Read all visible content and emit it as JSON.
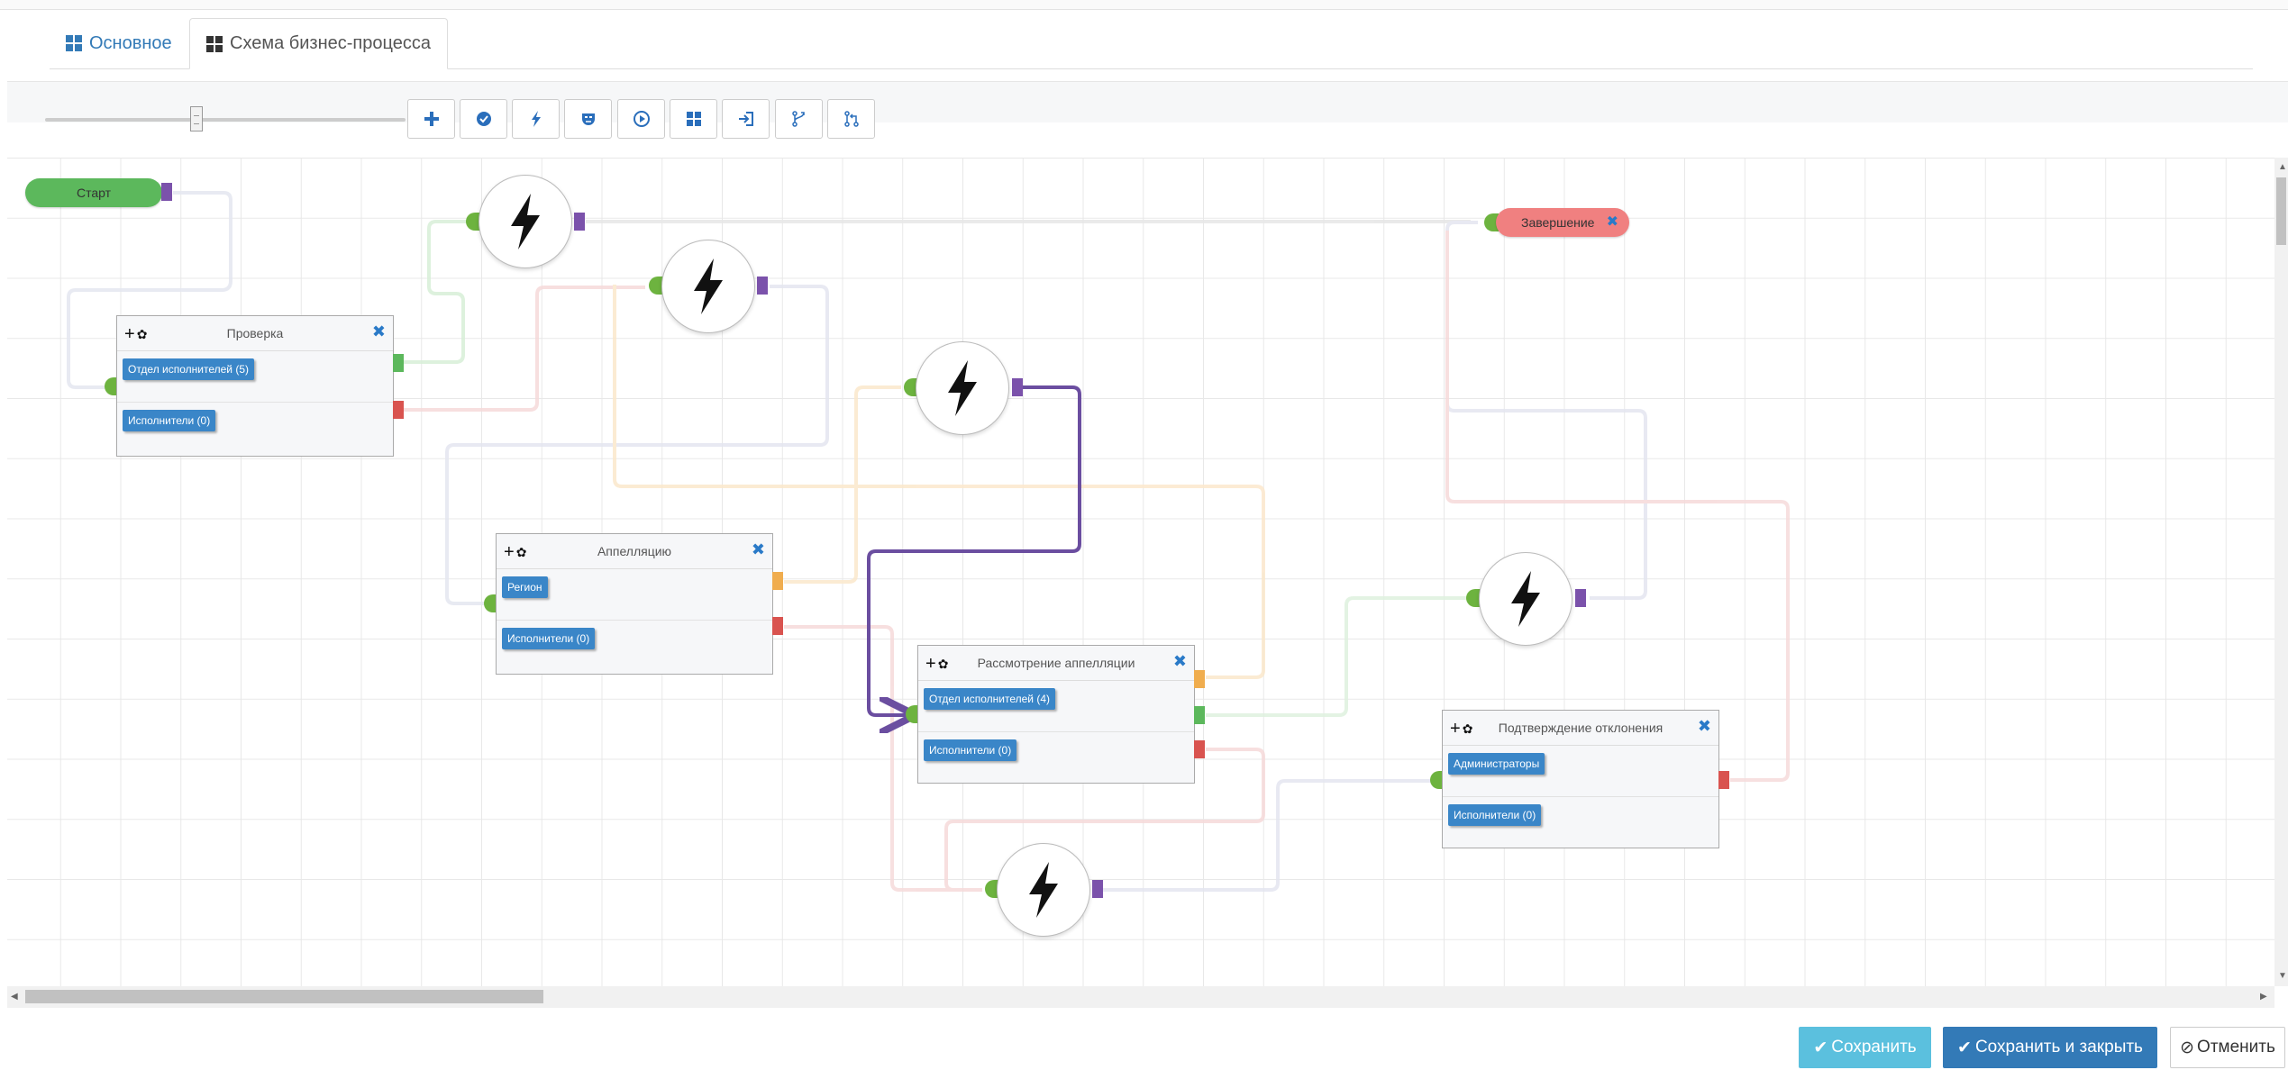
{
  "tabs": [
    {
      "label": "Основное",
      "active": false
    },
    {
      "label": "Схема бизнес-процесса",
      "active": true
    }
  ],
  "toolbar": {
    "zoom_level": 0.42,
    "buttons": [
      "add-icon",
      "check-circle-icon",
      "bolt-icon",
      "mask-icon",
      "play-circle-icon",
      "grid-icon",
      "sign-in-icon",
      "branch-icon",
      "merge-icon"
    ]
  },
  "diagram": {
    "start_label": "Старт",
    "end_label": "Завершение",
    "nodes": {
      "proverka": {
        "title": "Проверка",
        "tags": [
          "Отдел исполнителей (5)",
          "Исполнители (0)"
        ]
      },
      "appeal": {
        "title": "Аппелляцию",
        "tags": [
          "Регион",
          "Исполнители (0)"
        ]
      },
      "review": {
        "title": "Рассмотрение аппелляции",
        "tags": [
          "Отдел исполнителей (4)",
          "Исполнители (0)"
        ]
      },
      "confirm": {
        "title": "Подтверждение отклонения",
        "tags": [
          "Администраторы",
          "Исполнители (0)"
        ]
      }
    },
    "event_icon": "bolt-icon"
  },
  "colors": {
    "start": "#5cb85c",
    "end": "#f08080",
    "port_out": "#7b52ab",
    "port_ok": "#5cb85c",
    "port_fail": "#d9534f",
    "port_orange": "#f0ad4e",
    "port_in": "#6db33f",
    "active_edge": "#6b4ea0",
    "tag": "#3a86c8",
    "save": "#5bc0de",
    "save_close": "#337ab7"
  },
  "footer": {
    "save_label": "Сохранить",
    "save_close_label": "Сохранить и закрыть",
    "cancel_label": "Отменить"
  }
}
